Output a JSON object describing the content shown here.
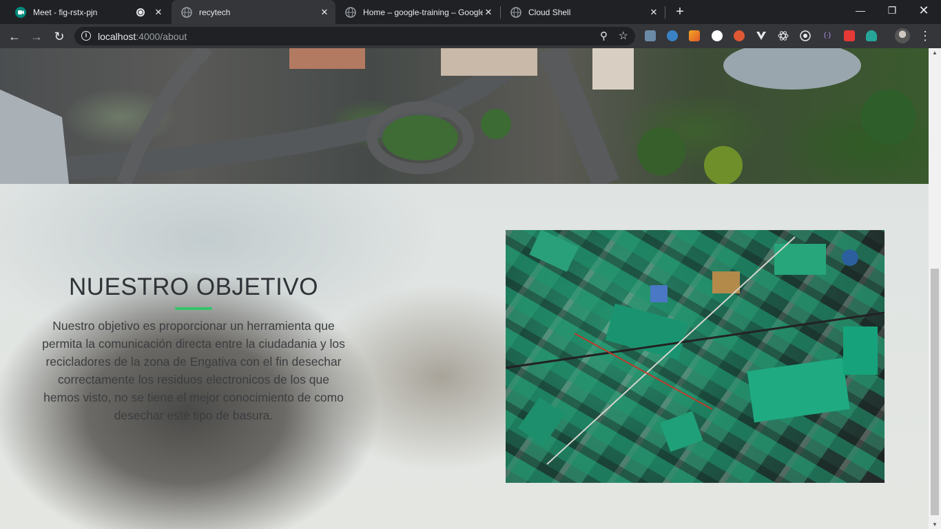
{
  "tabs": [
    {
      "title": "Meet - fig-rstx-pjn",
      "favicon": "google-meet-icon",
      "recording": true
    },
    {
      "title": "recytech",
      "favicon": "globe-icon",
      "active": true
    },
    {
      "title": "Home – google-training – Google",
      "favicon": "globe-icon"
    },
    {
      "title": "Cloud Shell",
      "favicon": "globe-icon"
    }
  ],
  "omnibox": {
    "host": "localhost",
    "path": ":4000/about"
  },
  "page": {
    "objective_title": "NUESTRO OBJETIVO",
    "objective_text": "Nuestro objetivo es proporcionar un herramienta que permita la comunicación directa entre la ciudadania y los recicladores de la zona de Engativa con el fin desechar correctamente los residuos electronicos de los que hemos visto, no se tiene el mejor conocimiento de como desechar este tipo de basura.",
    "accent_color": "#33c46a"
  },
  "extensions": [
    "ext-icon-1",
    "ext-icon-2",
    "ext-icon-3",
    "ext-icon-4",
    "ext-icon-5",
    "ext-icon-6",
    "ext-icon-7",
    "ext-icon-8",
    "ext-icon-9",
    "ext-icon-10",
    "ext-icon-11"
  ]
}
